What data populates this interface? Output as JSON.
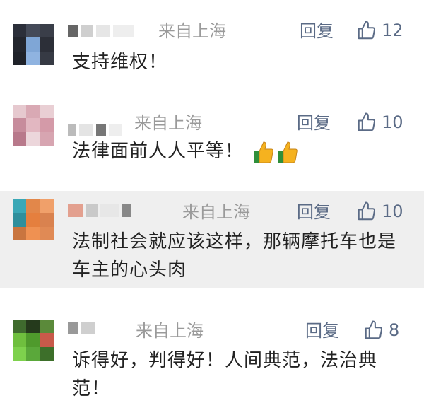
{
  "comments": [
    {
      "location": "来自上海",
      "reply": "回复",
      "likes": "12",
      "text": "支持维权！"
    },
    {
      "location": "来自上海",
      "reply": "回复",
      "likes": "10",
      "text": "法律面前人人平等！",
      "emoji": "thumbs-up-thumbs-up"
    },
    {
      "location": "来自上海",
      "reply": "回复",
      "likes": "10",
      "text": "法制社会就应该这样，那辆摩托车也是车主的心头肉"
    },
    {
      "location": "来自上海",
      "reply": "回复",
      "likes": "8",
      "text": "诉得好，判得好！人间典范，法治典范！"
    }
  ],
  "colors": {
    "link": "#5b6b86",
    "muted": "#9a9a9a",
    "highlight": "#efefef"
  },
  "icons": {
    "like": "thumbs-up-icon",
    "emoji": "thumbs-up-emoji"
  }
}
